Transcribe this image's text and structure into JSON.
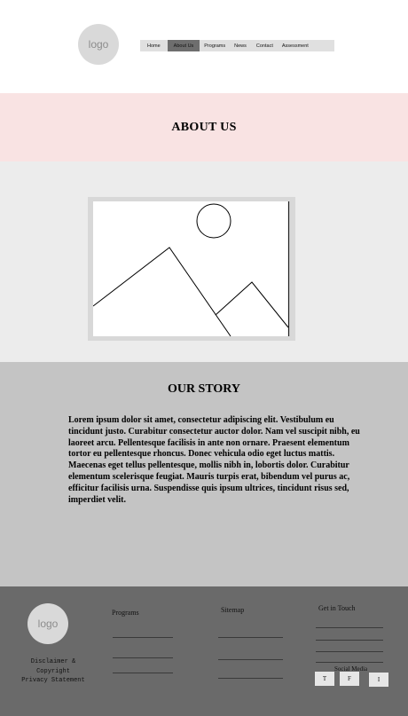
{
  "header": {
    "logo_text": "logo",
    "nav": [
      {
        "label": "Home"
      },
      {
        "label": "About Us"
      },
      {
        "label": "Programs"
      },
      {
        "label": "News"
      },
      {
        "label": "Contact"
      },
      {
        "label": "Assessment"
      }
    ],
    "active_nav": "About Us"
  },
  "about": {
    "title": "ABOUT US"
  },
  "image_placeholder": {
    "icon": "image-placeholder-icon"
  },
  "story": {
    "title": "OUR STORY",
    "body": "Lorem ipsum dolor sit amet, consectetur adipiscing elit. Vestibulum eu tincidunt justo. Curabitur consectetur auctor dolor. Nam vel suscipit nibh, eu laoreet arcu. Pellentesque facilisis in ante non ornare. Praesent elementum tortor eu pellentesque rhoncus. Donec vehicula odio eget luctus mattis. Maecenas eget tellus pellentesque, mollis nibh in, lobortis dolor. Curabitur elementum scelerisque feugiat. Mauris turpis erat, bibendum vel purus ac, efficitur facilisis urna. Suspendisse quis ipsum ultrices, tincidunt risus sed, imperdiet velit."
  },
  "footer": {
    "logo_text": "logo",
    "legal": [
      "Disclaimer &",
      "Copyright",
      "Privacy Statement"
    ],
    "programs_heading": "Programs",
    "sitemap_heading": "Sitemap",
    "contact_heading": "Get in Touch",
    "social_heading": "Social Media",
    "social": [
      "T",
      "F",
      "I"
    ]
  },
  "colors": {
    "about_band": "#f9e3e3",
    "image_band": "#ececec",
    "story_band": "#c4c4c4",
    "footer": "#6a6a6a",
    "nav_active": "#6e6e6e"
  }
}
